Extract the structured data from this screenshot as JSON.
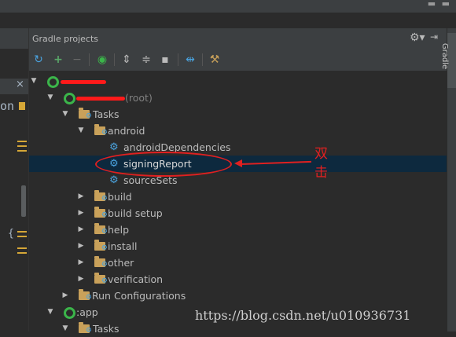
{
  "panel": {
    "title": "Gradle projects",
    "side_tab_label": "Gradle"
  },
  "editor": {
    "code_fragment": "on",
    "brace": "{",
    "close_glyph": "×"
  },
  "tree": {
    "root_label": "(root)",
    "tasks_label": "Tasks",
    "android_label": "android",
    "tasks_android": [
      "androidDependencies",
      "signingReport",
      "sourceSets"
    ],
    "task_groups": [
      "build",
      "build setup",
      "help",
      "install",
      "other",
      "verification"
    ],
    "run_configurations": "Run Configurations",
    "app_module": ":app",
    "app_tasks": "Tasks"
  },
  "annotation": {
    "double_click_chars": [
      "双",
      "击"
    ]
  },
  "watermark": "https://blog.csdn.net/u010936731",
  "colors": {
    "background": "#2b2b2b",
    "panel": "#3c3f41",
    "selection": "#0d293e",
    "folder": "#c9a15a",
    "gear": "#4aa3df",
    "gradle_green": "#3bb54a",
    "annotation_red": "#e02020"
  }
}
